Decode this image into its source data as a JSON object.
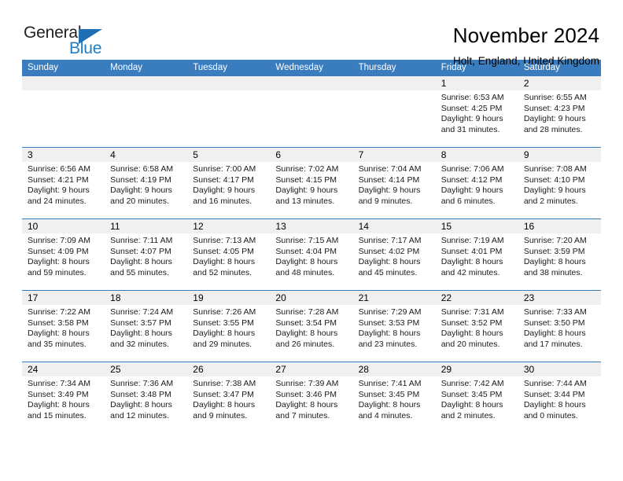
{
  "brand": {
    "name_top": "General",
    "name_bottom": "Blue",
    "accent_color": "#1f7cc4",
    "triangle_color": "#1f6fb5"
  },
  "header": {
    "title": "November 2024",
    "subtitle": "Holt, England, United Kingdom"
  },
  "calendar": {
    "header_bg": "#3a7dbf",
    "day_band_bg": "#f0f0f0",
    "weekdays": [
      "Sunday",
      "Monday",
      "Tuesday",
      "Wednesday",
      "Thursday",
      "Friday",
      "Saturday"
    ],
    "weeks": [
      [
        {
          "empty": true
        },
        {
          "empty": true
        },
        {
          "empty": true
        },
        {
          "empty": true
        },
        {
          "empty": true
        },
        {
          "day": "1",
          "sunrise": "Sunrise: 6:53 AM",
          "sunset": "Sunset: 4:25 PM",
          "daylight_1": "Daylight: 9 hours",
          "daylight_2": "and 31 minutes."
        },
        {
          "day": "2",
          "sunrise": "Sunrise: 6:55 AM",
          "sunset": "Sunset: 4:23 PM",
          "daylight_1": "Daylight: 9 hours",
          "daylight_2": "and 28 minutes."
        }
      ],
      [
        {
          "day": "3",
          "sunrise": "Sunrise: 6:56 AM",
          "sunset": "Sunset: 4:21 PM",
          "daylight_1": "Daylight: 9 hours",
          "daylight_2": "and 24 minutes."
        },
        {
          "day": "4",
          "sunrise": "Sunrise: 6:58 AM",
          "sunset": "Sunset: 4:19 PM",
          "daylight_1": "Daylight: 9 hours",
          "daylight_2": "and 20 minutes."
        },
        {
          "day": "5",
          "sunrise": "Sunrise: 7:00 AM",
          "sunset": "Sunset: 4:17 PM",
          "daylight_1": "Daylight: 9 hours",
          "daylight_2": "and 16 minutes."
        },
        {
          "day": "6",
          "sunrise": "Sunrise: 7:02 AM",
          "sunset": "Sunset: 4:15 PM",
          "daylight_1": "Daylight: 9 hours",
          "daylight_2": "and 13 minutes."
        },
        {
          "day": "7",
          "sunrise": "Sunrise: 7:04 AM",
          "sunset": "Sunset: 4:14 PM",
          "daylight_1": "Daylight: 9 hours",
          "daylight_2": "and 9 minutes."
        },
        {
          "day": "8",
          "sunrise": "Sunrise: 7:06 AM",
          "sunset": "Sunset: 4:12 PM",
          "daylight_1": "Daylight: 9 hours",
          "daylight_2": "and 6 minutes."
        },
        {
          "day": "9",
          "sunrise": "Sunrise: 7:08 AM",
          "sunset": "Sunset: 4:10 PM",
          "daylight_1": "Daylight: 9 hours",
          "daylight_2": "and 2 minutes."
        }
      ],
      [
        {
          "day": "10",
          "sunrise": "Sunrise: 7:09 AM",
          "sunset": "Sunset: 4:09 PM",
          "daylight_1": "Daylight: 8 hours",
          "daylight_2": "and 59 minutes."
        },
        {
          "day": "11",
          "sunrise": "Sunrise: 7:11 AM",
          "sunset": "Sunset: 4:07 PM",
          "daylight_1": "Daylight: 8 hours",
          "daylight_2": "and 55 minutes."
        },
        {
          "day": "12",
          "sunrise": "Sunrise: 7:13 AM",
          "sunset": "Sunset: 4:05 PM",
          "daylight_1": "Daylight: 8 hours",
          "daylight_2": "and 52 minutes."
        },
        {
          "day": "13",
          "sunrise": "Sunrise: 7:15 AM",
          "sunset": "Sunset: 4:04 PM",
          "daylight_1": "Daylight: 8 hours",
          "daylight_2": "and 48 minutes."
        },
        {
          "day": "14",
          "sunrise": "Sunrise: 7:17 AM",
          "sunset": "Sunset: 4:02 PM",
          "daylight_1": "Daylight: 8 hours",
          "daylight_2": "and 45 minutes."
        },
        {
          "day": "15",
          "sunrise": "Sunrise: 7:19 AM",
          "sunset": "Sunset: 4:01 PM",
          "daylight_1": "Daylight: 8 hours",
          "daylight_2": "and 42 minutes."
        },
        {
          "day": "16",
          "sunrise": "Sunrise: 7:20 AM",
          "sunset": "Sunset: 3:59 PM",
          "daylight_1": "Daylight: 8 hours",
          "daylight_2": "and 38 minutes."
        }
      ],
      [
        {
          "day": "17",
          "sunrise": "Sunrise: 7:22 AM",
          "sunset": "Sunset: 3:58 PM",
          "daylight_1": "Daylight: 8 hours",
          "daylight_2": "and 35 minutes."
        },
        {
          "day": "18",
          "sunrise": "Sunrise: 7:24 AM",
          "sunset": "Sunset: 3:57 PM",
          "daylight_1": "Daylight: 8 hours",
          "daylight_2": "and 32 minutes."
        },
        {
          "day": "19",
          "sunrise": "Sunrise: 7:26 AM",
          "sunset": "Sunset: 3:55 PM",
          "daylight_1": "Daylight: 8 hours",
          "daylight_2": "and 29 minutes."
        },
        {
          "day": "20",
          "sunrise": "Sunrise: 7:28 AM",
          "sunset": "Sunset: 3:54 PM",
          "daylight_1": "Daylight: 8 hours",
          "daylight_2": "and 26 minutes."
        },
        {
          "day": "21",
          "sunrise": "Sunrise: 7:29 AM",
          "sunset": "Sunset: 3:53 PM",
          "daylight_1": "Daylight: 8 hours",
          "daylight_2": "and 23 minutes."
        },
        {
          "day": "22",
          "sunrise": "Sunrise: 7:31 AM",
          "sunset": "Sunset: 3:52 PM",
          "daylight_1": "Daylight: 8 hours",
          "daylight_2": "and 20 minutes."
        },
        {
          "day": "23",
          "sunrise": "Sunrise: 7:33 AM",
          "sunset": "Sunset: 3:50 PM",
          "daylight_1": "Daylight: 8 hours",
          "daylight_2": "and 17 minutes."
        }
      ],
      [
        {
          "day": "24",
          "sunrise": "Sunrise: 7:34 AM",
          "sunset": "Sunset: 3:49 PM",
          "daylight_1": "Daylight: 8 hours",
          "daylight_2": "and 15 minutes."
        },
        {
          "day": "25",
          "sunrise": "Sunrise: 7:36 AM",
          "sunset": "Sunset: 3:48 PM",
          "daylight_1": "Daylight: 8 hours",
          "daylight_2": "and 12 minutes."
        },
        {
          "day": "26",
          "sunrise": "Sunrise: 7:38 AM",
          "sunset": "Sunset: 3:47 PM",
          "daylight_1": "Daylight: 8 hours",
          "daylight_2": "and 9 minutes."
        },
        {
          "day": "27",
          "sunrise": "Sunrise: 7:39 AM",
          "sunset": "Sunset: 3:46 PM",
          "daylight_1": "Daylight: 8 hours",
          "daylight_2": "and 7 minutes."
        },
        {
          "day": "28",
          "sunrise": "Sunrise: 7:41 AM",
          "sunset": "Sunset: 3:45 PM",
          "daylight_1": "Daylight: 8 hours",
          "daylight_2": "and 4 minutes."
        },
        {
          "day": "29",
          "sunrise": "Sunrise: 7:42 AM",
          "sunset": "Sunset: 3:45 PM",
          "daylight_1": "Daylight: 8 hours",
          "daylight_2": "and 2 minutes."
        },
        {
          "day": "30",
          "sunrise": "Sunrise: 7:44 AM",
          "sunset": "Sunset: 3:44 PM",
          "daylight_1": "Daylight: 8 hours",
          "daylight_2": "and 0 minutes."
        }
      ]
    ]
  }
}
